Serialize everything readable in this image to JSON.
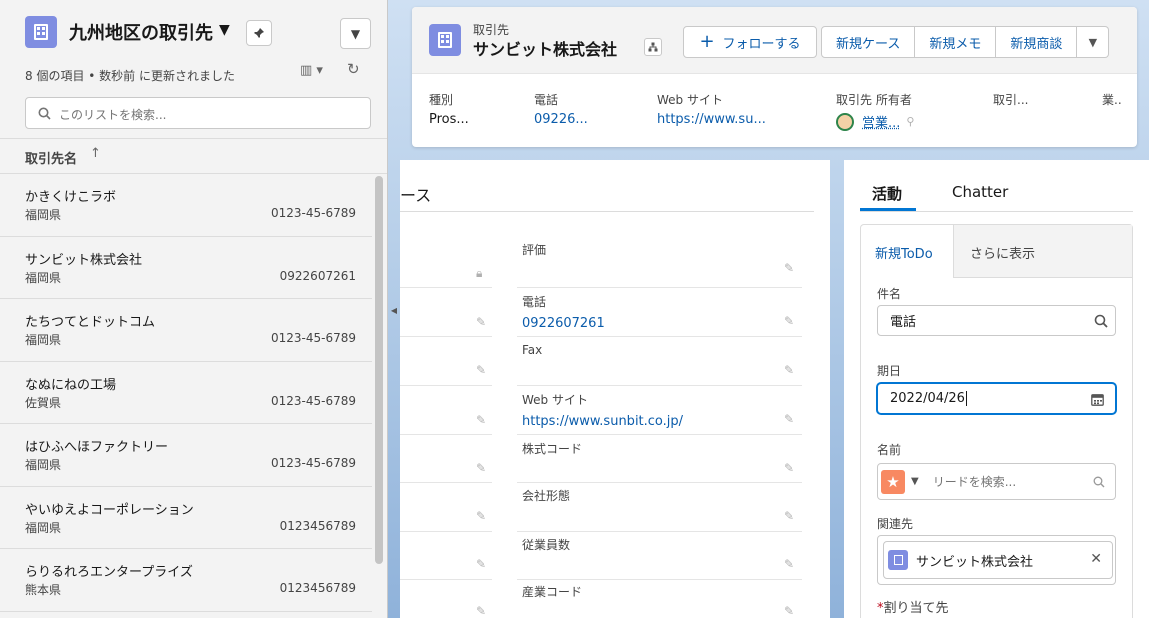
{
  "list_panel": {
    "title": "九州地区の取引先",
    "status": "8 個の項目 • 数秒前 に更新されました",
    "search_placeholder": "このリストを検索...",
    "column_header": "取引先名",
    "sort_arrow": "↑",
    "rows": [
      {
        "name": "かきくけこラボ",
        "prefecture": "福岡県",
        "phone": "0123-45-6789"
      },
      {
        "name": "サンビット株式会社",
        "prefecture": "福岡県",
        "phone": "0922607261"
      },
      {
        "name": "たちつてとドットコム",
        "prefecture": "福岡県",
        "phone": "0123-45-6789"
      },
      {
        "name": "なぬにねの工場",
        "prefecture": "佐賀県",
        "phone": "0123-45-6789"
      },
      {
        "name": "はひふへほファクトリー",
        "prefecture": "福岡県",
        "phone": "0123-45-6789"
      },
      {
        "name": "やいゆえよコーポレーション",
        "prefecture": "福岡県",
        "phone": "0123456789"
      },
      {
        "name": "らりるれろエンタープライズ",
        "prefecture": "熊本県",
        "phone": "0123456789"
      }
    ]
  },
  "record_header": {
    "object_label": "取引先",
    "record_name": "サンビット株式会社",
    "follow_label": "フォローする",
    "new_case_label": "新規ケース",
    "new_memo_label": "新規メモ",
    "new_deal_label": "新規商談",
    "fields": [
      {
        "label": "種別",
        "value": "Pros..."
      },
      {
        "label": "電話",
        "value": "09226..."
      },
      {
        "label": "Web サイト",
        "value": "https://www.su..."
      },
      {
        "label": "取引先 所有者",
        "value": "営業..."
      },
      {
        "label": "取引...",
        "value": ""
      },
      {
        "label": "業..",
        "value": ""
      }
    ]
  },
  "details": {
    "section_title": "ース",
    "fields": [
      {
        "label": "評価",
        "value": ""
      },
      {
        "label": "電話",
        "value": "0922607261"
      },
      {
        "label": "Fax",
        "value": ""
      },
      {
        "label": "Web サイト",
        "value": "https://www.sunbit.co.jp/"
      },
      {
        "label": "株式コード",
        "value": ""
      },
      {
        "label": "会社形態",
        "value": ""
      },
      {
        "label": "従業員数",
        "value": ""
      },
      {
        "label": "産業コード",
        "value": ""
      }
    ]
  },
  "activity": {
    "tabs": [
      "活動",
      "Chatter"
    ],
    "subtabs": [
      "新規ToDo",
      "さらに表示"
    ],
    "subject_label": "件名",
    "subject_value": "電話",
    "due_label": "期日",
    "due_value": "2022/04/26",
    "name_label": "名前",
    "lead_search_placeholder": "リードを検索...",
    "related_label": "関連先",
    "related_value": "サンビット株式会社",
    "assigned_label": "割り当て先",
    "required_mark": "*"
  },
  "colors": {
    "accent": "#0b5cab",
    "account_icon": "#7f8de1",
    "lead_icon": "#f88962"
  }
}
